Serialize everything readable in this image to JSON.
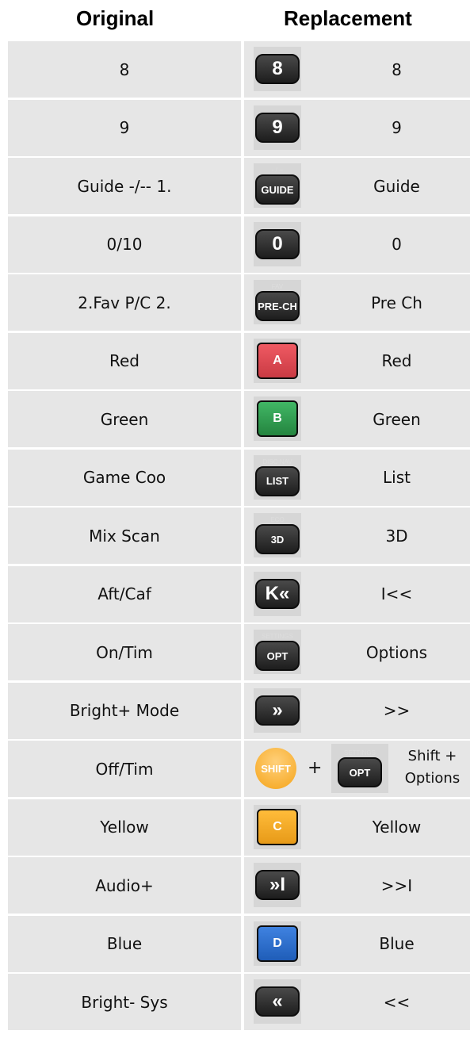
{
  "headers": {
    "original": "Original",
    "replacement": "Replacement"
  },
  "rows": [
    {
      "original": "8",
      "key_top": "",
      "key_text": "8",
      "replacement": "8",
      "color": "#1d1d1d"
    },
    {
      "original": "9",
      "key_top": "",
      "key_text": "9",
      "replacement": "9",
      "color": "#1d1d1d"
    },
    {
      "original": "Guide -/-- 1.",
      "key_top": "- / --",
      "key_text": "GUIDE",
      "replacement": "Guide",
      "color": "#1d1d1d"
    },
    {
      "original": "0/10",
      "key_top": "",
      "key_text": "0",
      "replacement": "0",
      "color": "#1d1d1d"
    },
    {
      "original": "2.Fav P/C 2.",
      "key_top": "FAV",
      "key_text": "PRE-CH",
      "replacement": "Pre Ch",
      "color": "#1d1d1d"
    },
    {
      "original": "Red",
      "key_top": "",
      "key_text": "A",
      "replacement": "Red",
      "color": "#e0464f"
    },
    {
      "original": "Green",
      "key_top": "",
      "key_text": "B",
      "replacement": "Green",
      "color": "#2f9a4f"
    },
    {
      "original": "Game Coo",
      "key_top": "DISC NAV",
      "key_text": "LIST",
      "replacement": "List",
      "color": "#1d1d1d"
    },
    {
      "original": "Mix Scan",
      "key_top": "ECO",
      "key_text": "3D",
      "replacement": "3D",
      "color": "#1d1d1d"
    },
    {
      "original": "Aft/Caf",
      "key_top": "",
      "key_text": "K«",
      "replacement": "I<<",
      "color": "#1d1d1d"
    },
    {
      "original": "On/Tim",
      "key_top": "SETTINGS",
      "key_text": "OPT",
      "replacement": "Options",
      "color": "#1d1d1d"
    },
    {
      "original": "Bright+ Mode",
      "key_top": "",
      "key_text": "»",
      "replacement": ">>",
      "color": "#1d1d1d"
    },
    {
      "original": "Off/Tim",
      "shift_label": "SHIFT",
      "plus": "+",
      "key_top": "SETTINGS",
      "key_text": "OPT",
      "replacement_line1": "Shift +",
      "replacement_line2": "Options",
      "color": "#1d1d1d"
    },
    {
      "original": "Yellow",
      "key_top": "",
      "key_text": "C",
      "replacement": "Yellow",
      "color": "#f5a623"
    },
    {
      "original": "Audio+",
      "key_top": "",
      "key_text": "»I",
      "replacement": ">>I",
      "color": "#1d1d1d"
    },
    {
      "original": "Blue",
      "key_top": "",
      "key_text": "D",
      "replacement": "Blue",
      "color": "#2d6fcf"
    },
    {
      "original": "Bright- Sys",
      "key_top": "",
      "key_text": "«",
      "replacement": "<<",
      "color": "#1d1d1d"
    }
  ]
}
